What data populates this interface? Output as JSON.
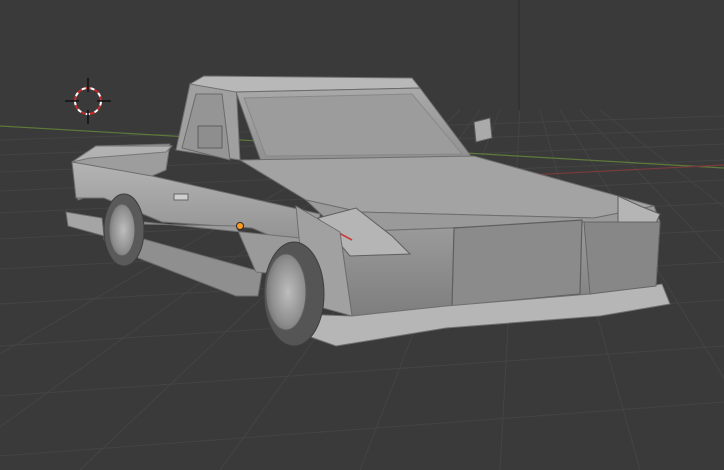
{
  "viewport": {
    "background_color": "#3a3a3a",
    "grid_color": "#444444",
    "grid_minor_color": "#404040",
    "x_axis_color": "#8a3c3c",
    "y_axis_color": "#5a7a3a",
    "z_axis_color": "#3a4a6a"
  },
  "scene": {
    "object": "low-poly-car-mesh",
    "object_color": "#a8a8a8",
    "object_shadow_color": "#7c7c7c",
    "object_highlight_color": "#c8c8c8",
    "origin_dot_color": "#ff9a20"
  },
  "gizmos": {
    "cursor": "3d-cursor-icon",
    "origin": "object-origin-icon"
  }
}
